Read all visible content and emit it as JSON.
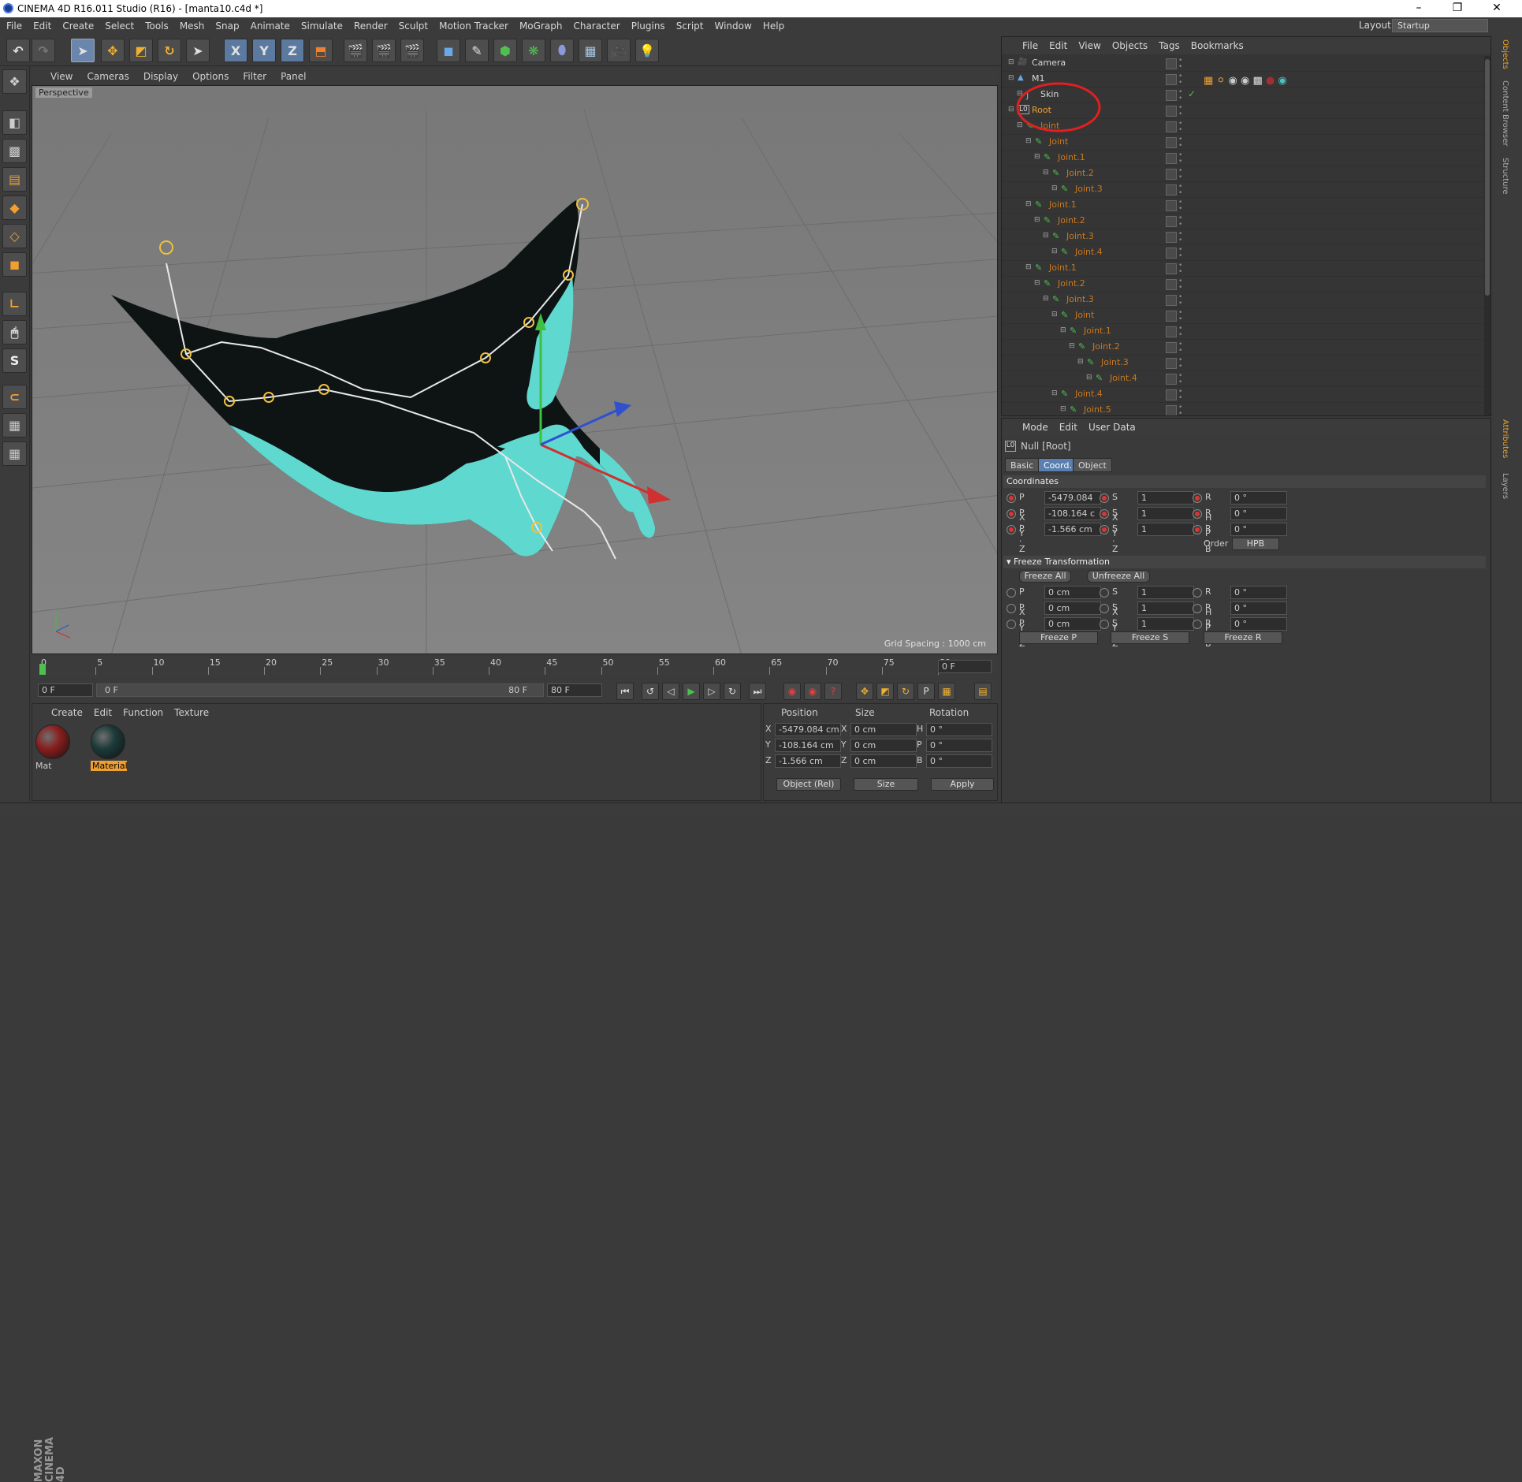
{
  "window": {
    "title": "CINEMA 4D R16.011 Studio (R16) - [manta10.c4d *]",
    "minimize": "–",
    "maximize": "❐",
    "close": "✕"
  },
  "menubar": [
    "File",
    "Edit",
    "Create",
    "Select",
    "Tools",
    "Mesh",
    "Snap",
    "Animate",
    "Simulate",
    "Render",
    "Sculpt",
    "Motion Tracker",
    "MoGraph",
    "Character",
    "Plugins",
    "Script",
    "Window",
    "Help"
  ],
  "layout": {
    "label": "Layout:",
    "value": "Startup"
  },
  "toolbar": {
    "x": "X",
    "y": "Y",
    "z": "Z"
  },
  "left_tools": {
    "s": "S"
  },
  "viewport": {
    "menu": [
      "View",
      "Cameras",
      "Display",
      "Options",
      "Filter",
      "Panel"
    ],
    "label": "Perspective",
    "grid_spacing": "Grid Spacing : 1000 cm"
  },
  "timeline": {
    "ticks": [
      "0",
      "5",
      "10",
      "15",
      "20",
      "25",
      "30",
      "35",
      "40",
      "45",
      "50",
      "55",
      "60",
      "65",
      "70",
      "75",
      "80"
    ],
    "current": "0 F"
  },
  "transport": {
    "start": "0 F",
    "range_start": "0 F",
    "range_end": "80 F",
    "end": "80 F"
  },
  "materials": {
    "menu": [
      "Create",
      "Edit",
      "Function",
      "Texture"
    ],
    "items": [
      {
        "name": "Mat",
        "color": "#8a1e1e"
      },
      {
        "name": "Material",
        "color": "#1c3a3a"
      }
    ]
  },
  "coords": {
    "headers": [
      "Position",
      "Size",
      "Rotation"
    ],
    "rows": [
      {
        "axis": "X",
        "pos": "-5479.084 cm",
        "saxis": "X",
        "size": "0 cm",
        "raxis": "H",
        "rot": "0 °"
      },
      {
        "axis": "Y",
        "pos": "-108.164 cm",
        "saxis": "Y",
        "size": "0 cm",
        "raxis": "P",
        "rot": "0 °"
      },
      {
        "axis": "Z",
        "pos": "-1.566 cm",
        "saxis": "Z",
        "size": "0 cm",
        "raxis": "B",
        "rot": "0 °"
      }
    ],
    "mode": "Object (Rel)",
    "size_mode": "Size",
    "apply": "Apply"
  },
  "objects": {
    "menu": [
      "File",
      "Edit",
      "View",
      "Objects",
      "Tags",
      "Bookmarks"
    ],
    "rows": [
      {
        "name": "Camera",
        "indent": 0,
        "color": "#d8d8d8"
      },
      {
        "name": "M1",
        "indent": 0,
        "color": "#d8d8d8"
      },
      {
        "name": "Skin",
        "indent": 1,
        "color": "#d8d8d8"
      },
      {
        "name": "Root",
        "indent": 0,
        "color": "#f0a030"
      },
      {
        "name": "Joint",
        "indent": 1,
        "color": "#c87820"
      },
      {
        "name": "Joint",
        "indent": 2,
        "color": "#c87820"
      },
      {
        "name": "Joint.1",
        "indent": 3,
        "color": "#c87820"
      },
      {
        "name": "Joint.2",
        "indent": 4,
        "color": "#c87820"
      },
      {
        "name": "Joint.3",
        "indent": 5,
        "color": "#c87820"
      },
      {
        "name": "Joint.1",
        "indent": 2,
        "color": "#c87820"
      },
      {
        "name": "Joint.2",
        "indent": 3,
        "color": "#c87820"
      },
      {
        "name": "Joint.3",
        "indent": 4,
        "color": "#c87820"
      },
      {
        "name": "Joint.4",
        "indent": 5,
        "color": "#c87820"
      },
      {
        "name": "Joint.1",
        "indent": 2,
        "color": "#c87820"
      },
      {
        "name": "Joint.2",
        "indent": 3,
        "color": "#c87820"
      },
      {
        "name": "Joint.3",
        "indent": 4,
        "color": "#c87820"
      },
      {
        "name": "Joint",
        "indent": 5,
        "color": "#c87820"
      },
      {
        "name": "Joint.1",
        "indent": 6,
        "color": "#c87820"
      },
      {
        "name": "Joint.2",
        "indent": 7,
        "color": "#c87820"
      },
      {
        "name": "Joint.3",
        "indent": 8,
        "color": "#c87820"
      },
      {
        "name": "Joint.4",
        "indent": 9,
        "color": "#c87820"
      },
      {
        "name": "Joint.4",
        "indent": 5,
        "color": "#c87820"
      },
      {
        "name": "Joint.5",
        "indent": 6,
        "color": "#c87820"
      }
    ]
  },
  "attributes": {
    "menu": [
      "Mode",
      "Edit",
      "User Data"
    ],
    "object_title": "Null [Root]",
    "tabs": [
      "Basic",
      "Coord.",
      "Object"
    ],
    "section_coords": "Coordinates",
    "pos": [
      {
        "label": "P . X",
        "value": "-5479.084"
      },
      {
        "label": "P . Y",
        "value": "-108.164 c"
      },
      {
        "label": "P . Z",
        "value": "-1.566 cm"
      }
    ],
    "scale": [
      {
        "label": "S . X",
        "value": "1"
      },
      {
        "label": "S . Y",
        "value": "1"
      },
      {
        "label": "S . Z",
        "value": "1"
      }
    ],
    "rot": [
      {
        "label": "R . H",
        "value": "0 °"
      },
      {
        "label": "R . P",
        "value": "0 °"
      },
      {
        "label": "R . B",
        "value": "0 °"
      }
    ],
    "order_label": "Order",
    "order_value": "HPB",
    "section_freeze": "Freeze Transformation",
    "freeze_all": "Freeze All",
    "unfreeze_all": "Unfreeze All",
    "fpos": [
      {
        "label": "P . X",
        "value": "0 cm"
      },
      {
        "label": "P . Y",
        "value": "0 cm"
      },
      {
        "label": "P . Z",
        "value": "0 cm"
      }
    ],
    "fscale": [
      {
        "label": "S . X",
        "value": "1"
      },
      {
        "label": "S . Y",
        "value": "1"
      },
      {
        "label": "S . Z",
        "value": "1"
      }
    ],
    "frot": [
      {
        "label": "R . H",
        "value": "0 °"
      },
      {
        "label": "R . P",
        "value": "0 °"
      },
      {
        "label": "R . B",
        "value": "0 °"
      }
    ],
    "freeze_p": "Freeze P",
    "freeze_s": "Freeze S",
    "freeze_r": "Freeze R"
  },
  "side_tabs": [
    "Objects",
    "Content Browser",
    "Structure",
    "Attributes",
    "Layers"
  ],
  "brand": "MAXON CINEMA 4D"
}
